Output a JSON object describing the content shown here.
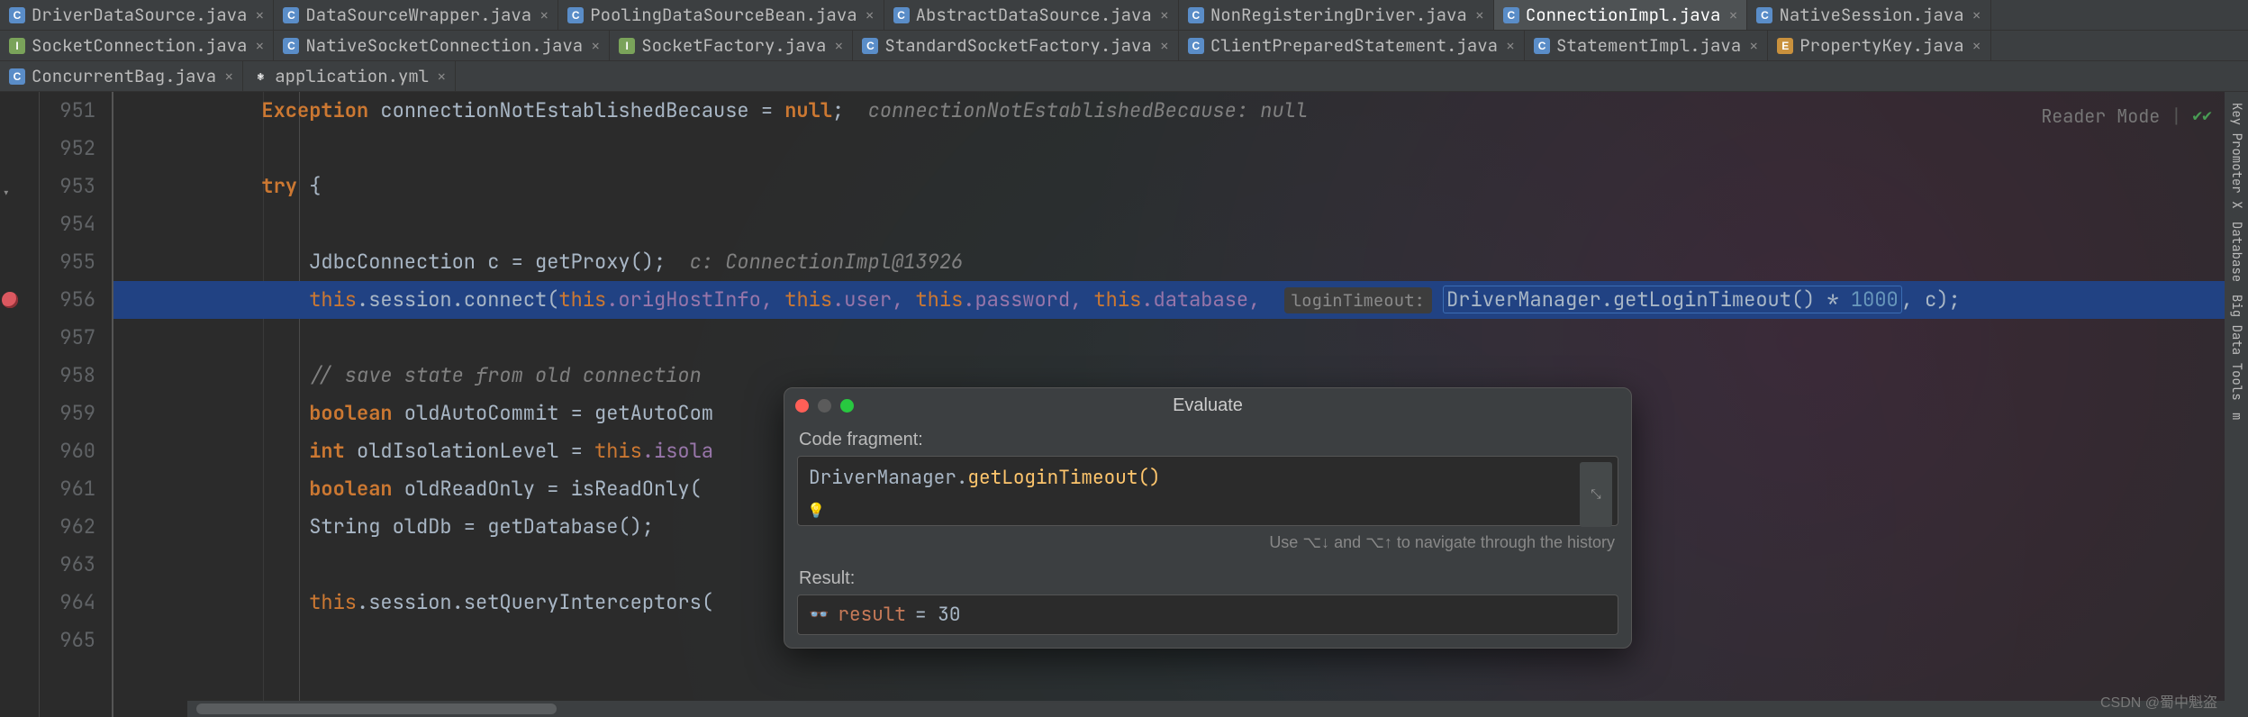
{
  "tabs_row1": [
    {
      "label": "DriverDataSource.java",
      "icon": "class"
    },
    {
      "label": "DataSourceWrapper.java",
      "icon": "class"
    },
    {
      "label": "PoolingDataSourceBean.java",
      "icon": "class"
    },
    {
      "label": "AbstractDataSource.java",
      "icon": "class"
    },
    {
      "label": "NonRegisteringDriver.java",
      "icon": "class"
    },
    {
      "label": "ConnectionImpl.java",
      "icon": "class",
      "active": true
    },
    {
      "label": "NativeSession.java",
      "icon": "class"
    }
  ],
  "tabs_row2": [
    {
      "label": "SocketConnection.java",
      "icon": "interface"
    },
    {
      "label": "NativeSocketConnection.java",
      "icon": "class"
    },
    {
      "label": "SocketFactory.java",
      "icon": "interface"
    },
    {
      "label": "StandardSocketFactory.java",
      "icon": "class"
    },
    {
      "label": "ClientPreparedStatement.java",
      "icon": "class"
    },
    {
      "label": "StatementImpl.java",
      "icon": "class"
    },
    {
      "label": "PropertyKey.java",
      "icon": "enum"
    }
  ],
  "tabs_row3": [
    {
      "label": "ConcurrentBag.java",
      "icon": "class"
    },
    {
      "label": "application.yml",
      "icon": "yml"
    }
  ],
  "reader_mode_label": "Reader Mode",
  "line_numbers": [
    "951",
    "952",
    "953",
    "954",
    "955",
    "956",
    "957",
    "958",
    "959",
    "960",
    "961",
    "962",
    "963",
    "964",
    "965"
  ],
  "code": {
    "l951_a": "Exception",
    "l951_b": " connectionNotEstablishedBecause = ",
    "l951_c": "null",
    "l951_d": ";  ",
    "l951_e": "connectionNotEstablishedBecause: null",
    "l953_a": "try",
    "l953_b": " {",
    "l955_a": "JdbcConnection c = getProxy();  ",
    "l955_b": "c: ConnectionImpl@13926",
    "l956_a": "this",
    "l956_b": ".session.connect(",
    "l956_c": "this",
    "l956_d": ".origHostInfo, ",
    "l956_e": "this",
    "l956_f": ".user, ",
    "l956_g": "this",
    "l956_h": ".password, ",
    "l956_i": "this",
    "l956_j": ".database, ",
    "l956_hint": "loginTimeout:",
    "l956_k": "DriverManager",
    "l956_l": ".getLoginTimeout() * ",
    "l956_m": "1000",
    "l956_n": ", c);",
    "l958": "// save state from old connection",
    "l959_a": "boolean",
    "l959_b": " oldAutoCommit = getAutoCom",
    "l960_a": "int",
    "l960_b": " oldIsolationLevel = ",
    "l960_c": "this",
    "l960_d": ".isola",
    "l961_a": "boolean",
    "l961_b": " oldReadOnly = isReadOnly(",
    "l962_a": "String",
    "l962_b": " oldDb = getDatabase();",
    "l964_a": "this",
    "l964_b": ".session.setQueryInterceptors("
  },
  "popup": {
    "title": "Evaluate",
    "code_fragment_label": "Code fragment:",
    "code_fragment_value": "DriverManager.getLoginTimeout()",
    "hint": "Use ⌥↓ and ⌥↑ to navigate through the history",
    "result_label": "Result:",
    "result_var": "result",
    "result_eq": " = 30"
  },
  "right_tools": [
    "Key Promoter X",
    "Database",
    "Big Data Tools",
    "m"
  ],
  "watermark": "CSDN @蜀中魁盗"
}
